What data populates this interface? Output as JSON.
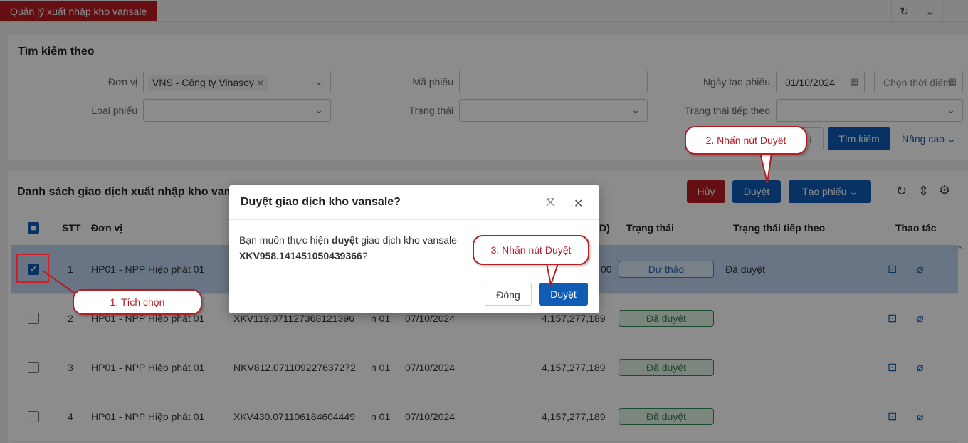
{
  "tabs": {
    "active_label": "Quản lý xuất nhập kho vansale"
  },
  "search": {
    "title": "Tìm kiếm theo",
    "don_vi_label": "Đơn vị",
    "don_vi_chip": "VNS - Công ty Vinasoy",
    "ma_phieu_label": "Mã phiếu",
    "ngay_tao_label": "Ngày tạo phiếu",
    "ngay_tao_from": "01/10/2024",
    "date_sep": "-",
    "ngay_tao_to_placeholder": "Chọn thời điểm",
    "loai_phieu_label": "Loại phiếu",
    "trang_thai_label": "Trạng thái",
    "trang_thai_tiep_label": "Trạng thái tiếp theo",
    "clear_label": "i",
    "search_button": "Tìm kiếm",
    "advanced_link": "Nâng cao"
  },
  "list": {
    "title": "Danh sách giao dịch xuất nhập kho van",
    "cancel_button": "Hủy",
    "approve_button": "Duyệt",
    "create_button": "Tạo phiếu",
    "columns": {
      "stt": "STT",
      "don_vi": "Đơn vị",
      "amount_tail": "D)",
      "trang_thai": "Trạng thái",
      "trang_thai_tiep": "Trạng thái tiếp theo",
      "thao_tac": "Thao tác"
    },
    "rows": [
      {
        "stt": "1",
        "don_vi": "HP01 - NPP Hiệp phát 01",
        "ma": "",
        "kho": "",
        "ngay": "",
        "amount": "00",
        "status": "Dự thảo",
        "next": "Đã duyệt"
      },
      {
        "stt": "2",
        "don_vi": "HP01 - NPP Hiệp phát 01",
        "ma": "XKV119.071127368121396",
        "kho": "n 01",
        "ngay": "07/10/2024",
        "amount": "4,157,277,189",
        "status": "Đã duyệt",
        "next": ""
      },
      {
        "stt": "3",
        "don_vi": "HP01 - NPP Hiệp phát 01",
        "ma": "NKV812.071109227637272",
        "kho": "n 01",
        "ngay": "07/10/2024",
        "amount": "4,157,277,189",
        "status": "Đã duyệt",
        "next": ""
      },
      {
        "stt": "4",
        "don_vi": "HP01 - NPP Hiệp phát 01",
        "ma": "XKV430.071106184604449",
        "kho": "n 01",
        "ngay": "07/10/2024",
        "amount": "4,157,277,189",
        "status": "Đã duyệt",
        "next": ""
      }
    ]
  },
  "dialog": {
    "title": "Duyệt giao dịch kho vansale?",
    "body_prefix": "Bạn muốn thực hiện ",
    "body_bold": "duyệt",
    "body_suffix": " giao dịch kho vansale",
    "code": "XKV958.141451050439366",
    "question_mark": "?",
    "close_button": "Đóng",
    "approve_button": "Duyệt"
  },
  "annotations": {
    "step1": "1. Tích chọn",
    "step2": "2. Nhấn nút Duyệt",
    "step3": "3. Nhấn nút Duyệt"
  },
  "colors": {
    "brand_red": "#b81c23",
    "primary_blue": "#0f5cb5",
    "annotation_red": "#b21f25"
  }
}
